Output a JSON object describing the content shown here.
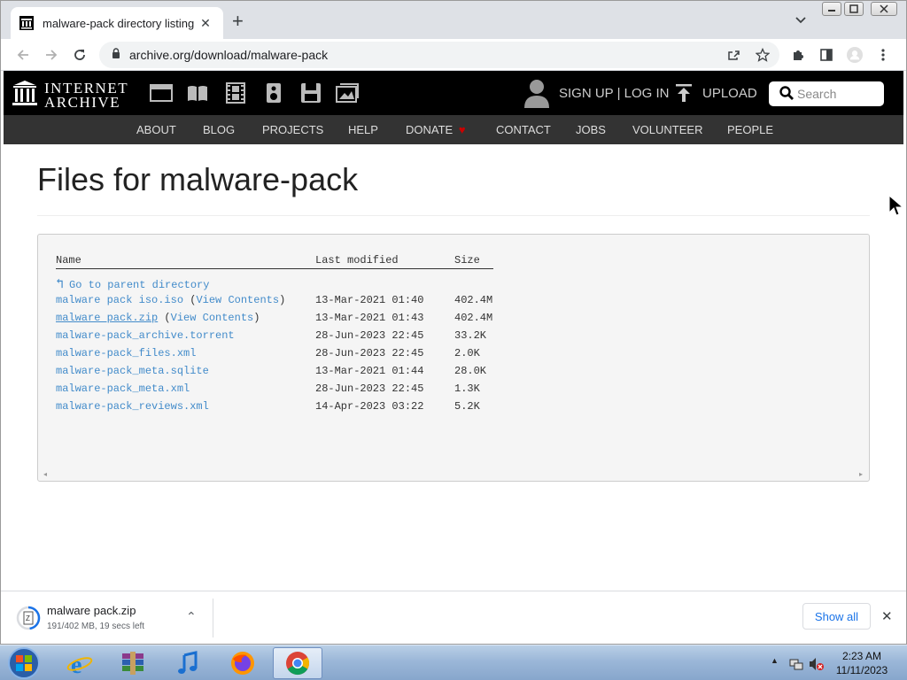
{
  "browser": {
    "tab_title": "malware-pack directory listing",
    "tab_close": "✕",
    "new_tab": "+",
    "url": "archive.org/download/malware-pack"
  },
  "ia_header": {
    "logo_line1": "INTERNET",
    "logo_line2": "ARCHIVE",
    "signin": "SIGN UP | LOG IN",
    "upload": "UPLOAD",
    "search_placeholder": "Search",
    "nav": [
      "ABOUT",
      "BLOG",
      "PROJECTS",
      "HELP",
      "DONATE",
      "CONTACT",
      "JOBS",
      "VOLUNTEER",
      "PEOPLE"
    ],
    "donate_heart": "♥",
    "donate_heart_color": "#cc0000"
  },
  "main": {
    "title": "Files for malware-pack",
    "columns": {
      "name": "Name",
      "modified": "Last modified",
      "size": "Size"
    },
    "parent_arrow": "↰",
    "parent_link": "Go to parent directory",
    "view_contents": "View Contents",
    "files": [
      {
        "name": "malware pack iso.iso",
        "view": true,
        "modified": "13-Mar-2021 01:40",
        "size": "402.4M"
      },
      {
        "name": "malware pack.zip",
        "view": true,
        "modified": "13-Mar-2021 01:43",
        "size": "402.4M"
      },
      {
        "name": "malware-pack_archive.torrent",
        "view": false,
        "modified": "28-Jun-2023 22:45",
        "size": "33.2K"
      },
      {
        "name": "malware-pack_files.xml",
        "view": false,
        "modified": "28-Jun-2023 22:45",
        "size": "2.0K"
      },
      {
        "name": "malware-pack_meta.sqlite",
        "view": false,
        "modified": "13-Mar-2021 01:44",
        "size": "28.0K"
      },
      {
        "name": "malware-pack_meta.xml",
        "view": false,
        "modified": "28-Jun-2023 22:45",
        "size": "1.3K"
      },
      {
        "name": "malware-pack_reviews.xml",
        "view": false,
        "modified": "14-Apr-2023 03:22",
        "size": "5.2K"
      }
    ],
    "scroll_left": "◂",
    "scroll_right": "▸"
  },
  "download": {
    "filename": "malware pack.zip",
    "status": "191/402 MB, 19 secs left",
    "progress_fraction": 0.475,
    "show_all": "Show all",
    "close": "✕",
    "chevron": "⌃"
  },
  "taskbar": {
    "time": "2:23 AM",
    "date": "11/11/2023",
    "apps": [
      "internet-explorer",
      "winrar",
      "itunes",
      "firefox",
      "chrome"
    ],
    "active_app": "chrome"
  },
  "colors": {
    "link": "#428bca",
    "ia_black": "#000000",
    "ia_nav": "#333333",
    "chrome_blue": "#1a73e8"
  }
}
